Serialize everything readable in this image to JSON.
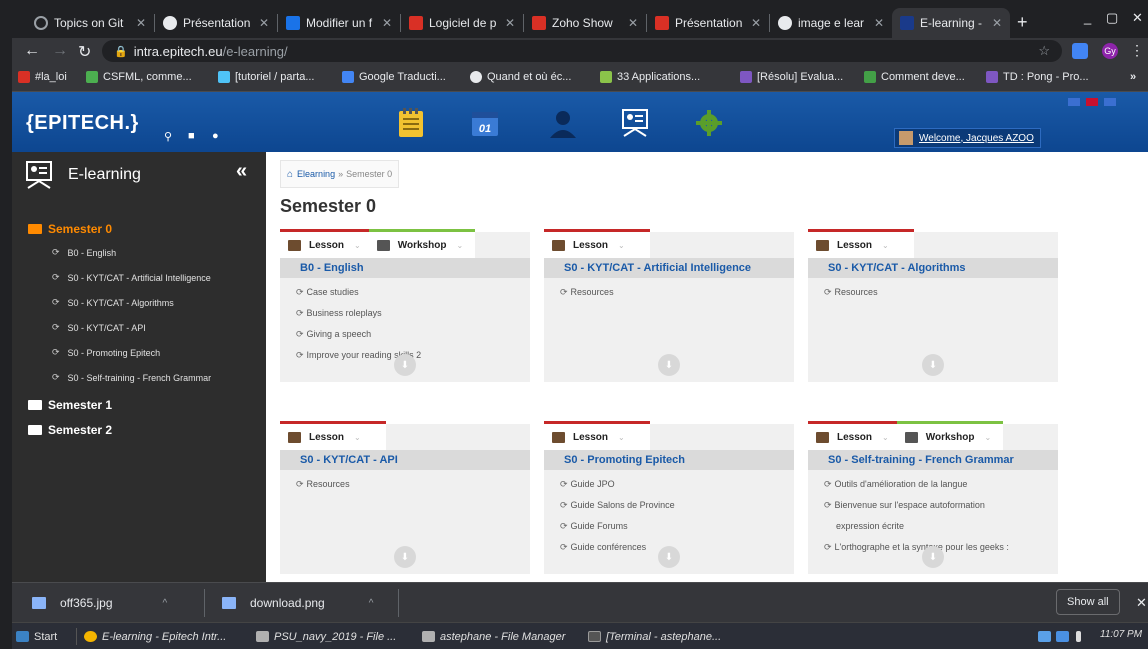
{
  "browser": {
    "tabs": [
      {
        "label": "Topics on Git",
        "color": "#5f6368"
      },
      {
        "label": "Présentation",
        "color": "#e8eaed"
      },
      {
        "label": "Modifier un f",
        "color": "#1a73e8"
      },
      {
        "label": "Logiciel de p",
        "color": "#d93025"
      },
      {
        "label": "Zoho Show",
        "color": "#d93025"
      },
      {
        "label": "Présentation",
        "color": "#d93025"
      },
      {
        "label": "image e lear",
        "color": "#e8eaed"
      },
      {
        "label": "E-learning -",
        "color": "#1a3a8a"
      }
    ],
    "url_host": "intra.epitech.eu",
    "url_path": "/e-learning/",
    "bookmarks": [
      "#la_loi",
      "CSFML, comme...",
      "[tutoriel / parta...",
      "Google Traducti...",
      "Quand et où éc...",
      "33 Applications...",
      "[Résolu] Evalua...",
      "Comment deve...",
      "TD : Pong - Pro..."
    ],
    "ext_label": "Gy"
  },
  "site": {
    "logo": "{EPITECH.}",
    "welcome": "Welcome, Jacques AZOO",
    "header_icons": [
      "notes-icon",
      "calendar-icon",
      "user-icon",
      "elearning-icon",
      "settings-icon"
    ],
    "accent": "#1a5aa8"
  },
  "sidebar": {
    "title": "E-learning",
    "collapse_label": "«",
    "semesters": [
      {
        "label": "Semester 0",
        "color": "#ff8a00"
      },
      {
        "label": "Semester 1",
        "color": "#ffffff"
      },
      {
        "label": "Semester 2",
        "color": "#ffffff"
      }
    ],
    "courses": [
      "B0 - English",
      "S0 - KYT/CAT - Artificial Intelligence",
      "S0 - KYT/CAT - Algorithms",
      "S0 - KYT/CAT - API",
      "S0 - Promoting Epitech",
      "S0 - Self-training - French Grammar"
    ]
  },
  "main": {
    "breadcrumb_root": "Elearning",
    "breadcrumb_sep": "»",
    "breadcrumb_current": "Semester 0",
    "title": "Semester 0",
    "lesson_label": "Lesson",
    "workshop_label": "Workshop",
    "cards": [
      {
        "title": "B0 - English",
        "items": [
          "Case studies",
          "Business roleplays",
          "Giving a speech",
          "Improve your reading skills 2"
        ]
      },
      {
        "title": "S0 - KYT/CAT - Artificial Intelligence",
        "items": [
          "Resources"
        ]
      },
      {
        "title": "S0 - KYT/CAT - Algorithms",
        "items": [
          "Resources"
        ]
      },
      {
        "title": "S0 - KYT/CAT - API",
        "items": [
          "Resources"
        ]
      },
      {
        "title": "S0 - Promoting Epitech",
        "items": [
          "Guide JPO",
          "Guide Salons de Province",
          "Guide Forums",
          "Guide conférences"
        ]
      },
      {
        "title": "S0 - Self-training - French Grammar",
        "items": [
          "Outils d'amélioration de la langue",
          "Bienvenue sur l'espace autoformation",
          "expression écrite",
          "L'orthographe et la syntaxe pour les geeks :"
        ]
      }
    ]
  },
  "downloads": {
    "files": [
      "off365.jpg",
      "download.png"
    ],
    "show_all": "Show all"
  },
  "taskbar": {
    "start": "Start",
    "items": [
      "E-learning - Epitech Intr...",
      "PSU_navy_2019 - File ...",
      "astephane - File Manager",
      "[Terminal - astephane..."
    ],
    "clock": "11:07 PM"
  }
}
